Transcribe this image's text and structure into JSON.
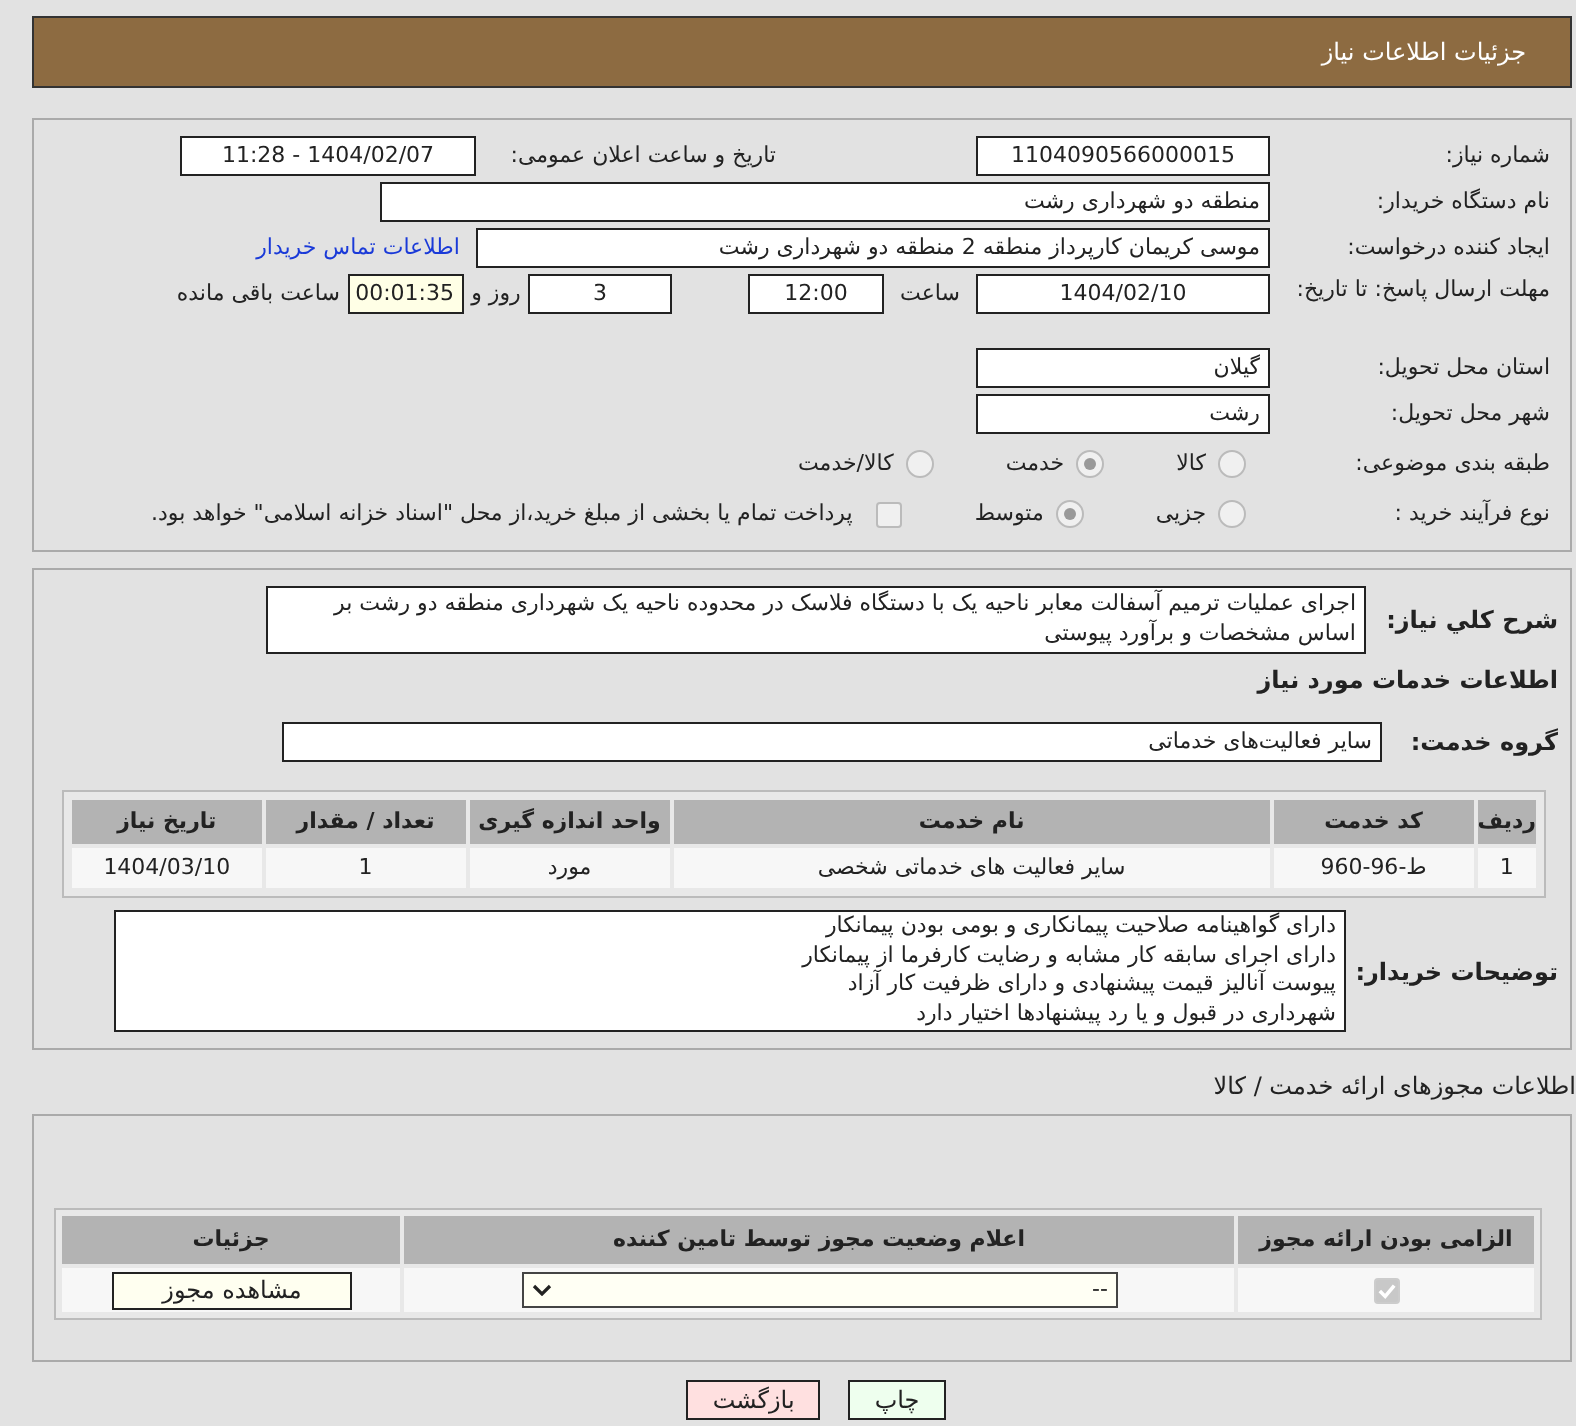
{
  "header": {
    "title": "جزئیات اطلاعات نیاز"
  },
  "need_number": {
    "label": "شماره نیاز:",
    "value": "1104090566000015"
  },
  "announce": {
    "label": "تاریخ و ساعت اعلان عمومی:",
    "value": "1404/02/07 - 11:28"
  },
  "buyer_org": {
    "label": "نام دستگاه خریدار:",
    "value": "منطقه دو شهرداری رشت"
  },
  "requester": {
    "label": "ایجاد کننده درخواست:",
    "value": "موسی کریمان کارپرداز منطقه 2 منطقه دو شهرداری رشت",
    "link": "اطلاعات تماس خریدار"
  },
  "deadline": {
    "label": "مهلت ارسال پاسخ: تا تاریخ:",
    "date": "1404/02/10",
    "time_label": "ساعت",
    "time": "12:00",
    "days": "3",
    "days_label": "روز و",
    "remaining": "00:01:35",
    "remaining_label": "ساعت باقی مانده"
  },
  "province": {
    "label": "استان محل تحویل:",
    "value": "گیلان"
  },
  "city": {
    "label": "شهر محل تحویل:",
    "value": "رشت"
  },
  "category": {
    "label": "طبقه بندی موضوعی:",
    "options": [
      {
        "label": "کالا",
        "selected": false
      },
      {
        "label": "خدمت",
        "selected": true
      },
      {
        "label": "کالا/خدمت",
        "selected": false
      }
    ]
  },
  "purchase_type": {
    "label": "نوع فرآیند خرید :",
    "options": [
      {
        "label": "جزیی",
        "selected": false
      },
      {
        "label": "متوسط",
        "selected": true
      }
    ],
    "payment_note": {
      "label": "پرداخت تمام یا بخشی از مبلغ خرید،از محل \"اسناد خزانه اسلامی\" خواهد بود.",
      "checked": false
    }
  },
  "description": {
    "label": "شرح کلي نياز:",
    "value": "اجرای عملیات ترمیم آسفالت معابر ناحیه یک با دستگاه فلاسک در محدوده ناحیه یک شهرداری منطقه دو رشت بر اساس مشخصات و برآورد پیوستی"
  },
  "services_heading": "اطلاعات خدمات مورد نیاز",
  "service_group": {
    "label": "گروه خدمت:",
    "value": "سایر فعالیت‌های خدماتی"
  },
  "services_table": {
    "columns": [
      "ردیف",
      "کد خدمت",
      "نام خدمت",
      "واحد اندازه گیری",
      "تعداد / مقدار",
      "تاریخ نیاز"
    ],
    "rows": [
      [
        "1",
        "ط-96-960",
        "سایر فعالیت های خدماتی شخصی",
        "مورد",
        "1",
        "1404/03/10"
      ]
    ]
  },
  "buyer_notes": {
    "label": "توضیحات خریدار:",
    "lines": [
      "دارای گواهینامه صلاحیت پیمانکاری و بومی بودن پیمانکار",
      "دارای اجرای سابقه کار مشابه و رضایت کارفرما از پیمانکار",
      "پیوست آنالیز قیمت پیشنهادی و  دارای ظرفیت کار آزاد",
      "شهرداری در قبول و یا رد پیشنهادها اختیار دارد"
    ]
  },
  "permits_heading": "اطلاعات مجوزهای ارائه خدمت / کالا",
  "permits_table": {
    "columns": [
      "الزامی بودن ارائه مجوز",
      "اعلام وضعیت مجوز توسط تامین کننده",
      "جزئیات"
    ],
    "rows": [
      {
        "required": true,
        "status": "--",
        "button": "مشاهده مجوز"
      }
    ]
  },
  "buttons": [
    {
      "label": "چاپ",
      "kind": "print"
    },
    {
      "label": "بازگشت",
      "kind": "back"
    }
  ]
}
